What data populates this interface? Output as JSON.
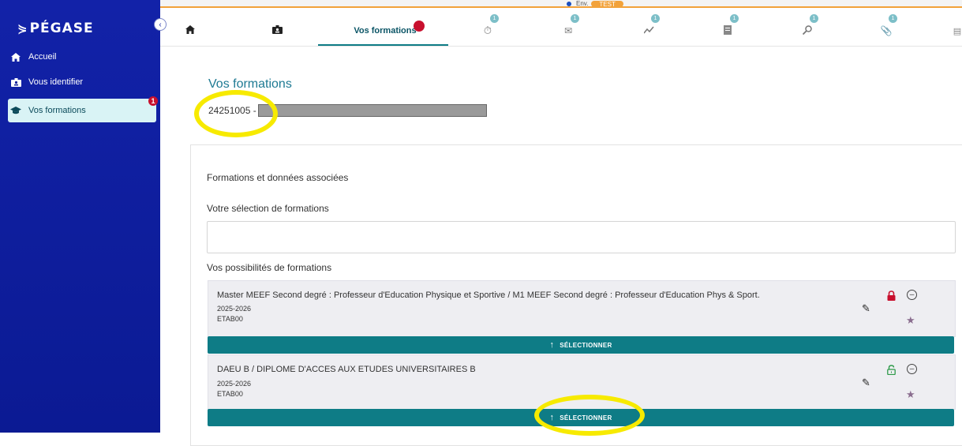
{
  "app": {
    "logo_text": "PÉGASE",
    "env_label": "Env.",
    "env_value": "TEST"
  },
  "sidebar": {
    "items": [
      {
        "label": "Accueil",
        "icon": "home-icon"
      },
      {
        "label": "Vous identifier",
        "icon": "id-card-icon"
      },
      {
        "label": "Vos formations",
        "icon": "graduation-cap-icon",
        "badge": "1",
        "active": true
      }
    ]
  },
  "tabs": [
    {
      "icon": "home-icon"
    },
    {
      "icon": "id-card-icon"
    },
    {
      "label": "Vos formations",
      "active": true,
      "badge_color": "#c8102e"
    },
    {
      "icon": "timer-icon",
      "badge": "1"
    },
    {
      "icon": "mail-icon",
      "badge": "1"
    },
    {
      "icon": "chart-line-icon",
      "badge": "1"
    },
    {
      "icon": "document-icon",
      "badge": "1"
    },
    {
      "icon": "search-icon",
      "badge": "1"
    },
    {
      "icon": "paperclip-icon",
      "badge": "1"
    },
    {
      "icon": "table-icon"
    }
  ],
  "main": {
    "title": "Vos formations",
    "student_id": "24251005 -",
    "section_title": "Formations et données associées",
    "selection_label": "Votre sélection de formations",
    "possibilities_label": "Vos possibilités de formations",
    "formations": [
      {
        "name": "Master MEEF Second degré : Professeur d'Education Physique et Sportive / M1 MEEF Second degré : Professeur d'Education Phys & Sport.",
        "year": "2025-2026",
        "etab": "ETAB00",
        "lock": "locked",
        "button": "SÉLECTIONNER"
      },
      {
        "name": "DAEU B / DIPLOME D'ACCES AUX ETUDES UNIVERSITAIRES B",
        "year": "2025-2026",
        "etab": "ETAB00",
        "lock": "unlocked",
        "button": "SÉLECTIONNER"
      }
    ]
  },
  "colors": {
    "sidebar": "#0f1d99",
    "accent": "#0e7c86",
    "highlight": "#f7ea00",
    "badge": "#c8102e"
  }
}
